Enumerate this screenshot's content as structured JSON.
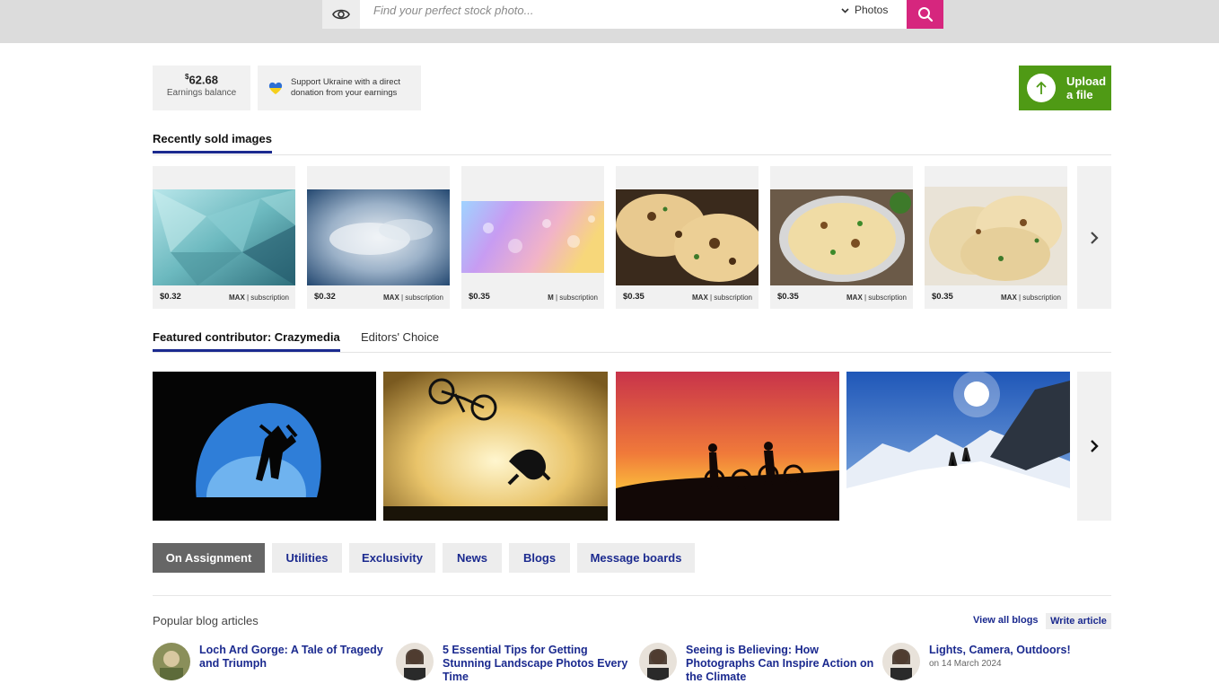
{
  "search": {
    "placeholder": "Find your perfect stock photo...",
    "type_label": "Photos"
  },
  "earnings": {
    "currency": "$",
    "amount": "62.68",
    "label": "Earnings balance"
  },
  "ukraine": {
    "text": "Support Ukraine with a direct donation from your earnings"
  },
  "upload": {
    "label_line1": "Upload",
    "label_line2": "a file"
  },
  "recent": {
    "title": "Recently sold images",
    "cards": [
      {
        "price": "$0.32",
        "size": "MAX",
        "lic": " | subscription"
      },
      {
        "price": "$0.32",
        "size": "MAX",
        "lic": " | subscription"
      },
      {
        "price": "$0.35",
        "size": "M",
        "lic": " | subscription"
      },
      {
        "price": "$0.35",
        "size": "MAX",
        "lic": " | subscription"
      },
      {
        "price": "$0.35",
        "size": "MAX",
        "lic": " | subscription"
      },
      {
        "price": "$0.35",
        "size": "MAX",
        "lic": " | subscription"
      }
    ]
  },
  "featured": {
    "tab_active": "Featured contributor: Crazymedia",
    "tab_other": "Editors' Choice"
  },
  "nav": {
    "items": [
      "On Assignment",
      "Utilities",
      "Exclusivity",
      "News",
      "Blogs",
      "Message boards"
    ]
  },
  "blogs": {
    "title": "Popular blog articles",
    "view_all": "View all blogs",
    "write": "Write article",
    "articles": [
      {
        "title": "Loch Ard Gorge: A Tale of Tragedy and Triumph"
      },
      {
        "title": "5 Essential Tips for Getting Stunning Landscape Photos Every Time"
      },
      {
        "title": "Seeing is Believing: How Photographs Can Inspire Action on the Climate"
      },
      {
        "title": "Lights, Camera, Outdoors!",
        "date": "on 14 March 2024"
      }
    ]
  },
  "colors": {
    "accent": "#d6267e",
    "brand_blue": "#1b2a8f",
    "upload_green": "#4f9a15"
  }
}
